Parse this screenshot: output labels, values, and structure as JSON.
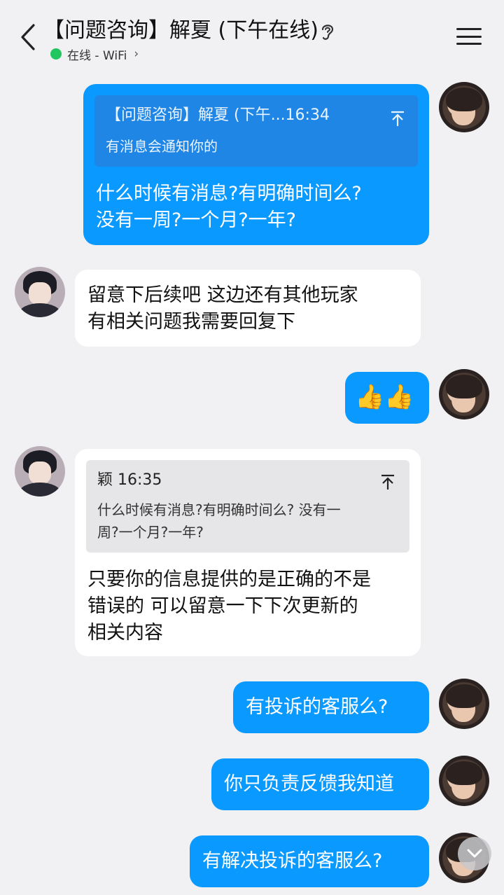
{
  "header": {
    "title": "【问题咨询】解夏 (下午在线)",
    "status": "在线 - WiFi",
    "status_chevron": "›"
  },
  "messages": {
    "m1": {
      "quote_head": "【问题咨询】解夏 (下午...16:34",
      "quote_body": "有消息会通知你的",
      "line1": "什么时候有消息?有明确时间么?",
      "line2": "没有一周?一个月?一年?"
    },
    "m2": {
      "line1": "留意下后续吧 这边还有其他玩家",
      "line2": "有相关问题我需要回复下"
    },
    "m3": {
      "emoji": "👍👍"
    },
    "m4": {
      "quote_head": "颖 16:35",
      "quote_line1": "什么时候有消息?有明确时间么? 没有一",
      "quote_line2": "周?一个月?一年?",
      "line1": "只要你的信息提供的是正确的不是",
      "line2": "错误的 可以留意一下下次更新的",
      "line3": "相关内容"
    },
    "m5": {
      "text": "有投诉的客服么?"
    },
    "m6": {
      "text": "你只负责反馈我知道"
    },
    "m7": {
      "text": "有解决投诉的客服么?"
    }
  }
}
